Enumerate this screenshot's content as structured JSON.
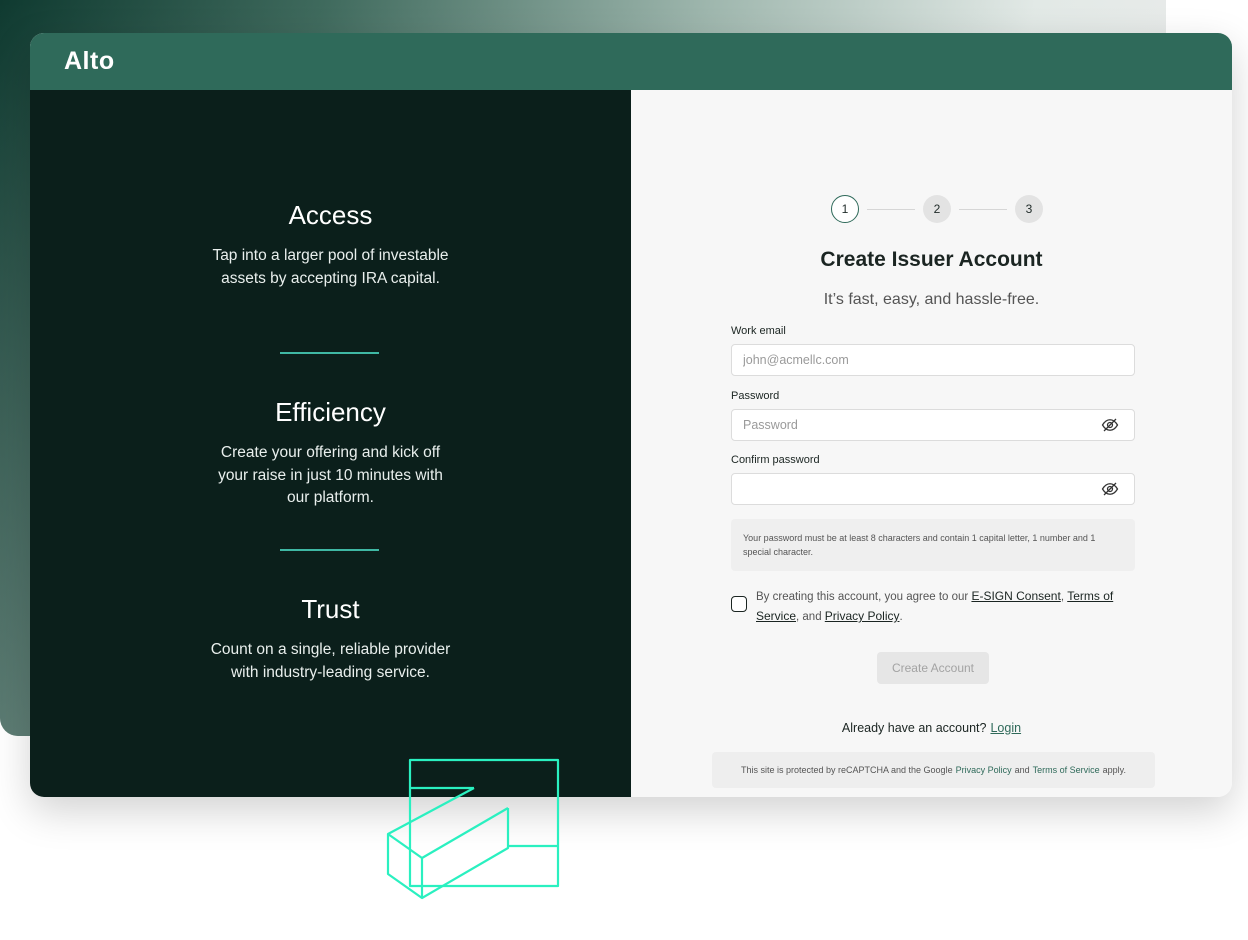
{
  "app": {
    "logo": "Alto"
  },
  "features": [
    {
      "title": "Access",
      "description": "Tap into a larger pool of investable assets by accepting IRA capital."
    },
    {
      "title": "Efficiency",
      "description": "Create your offering and kick off your raise in just 10 minutes with our platform."
    },
    {
      "title": "Trust",
      "description": "Count on a single, reliable provider with industry-leading service."
    }
  ],
  "stepper": {
    "steps": [
      "1",
      "2",
      "3"
    ],
    "active_step": "1"
  },
  "form": {
    "title": "Create Issuer Account",
    "subtitle": "It’s fast, easy, and hassle-free.",
    "email_label": "Work email",
    "email_placeholder": "john@acmellc.com",
    "email_value": "",
    "password_label": "Password",
    "password_placeholder": "Password",
    "password_value": "",
    "confirm_label": "Confirm password",
    "confirm_placeholder": "",
    "confirm_value": "",
    "password_hint": "Your password must be at least 8 characters and contain 1 capital letter, 1 number and 1 special character.",
    "consent_prefix": "By creating this account, you agree to our",
    "esign_link": "E-SIGN Consent",
    "terms_link": "Terms of Service",
    "consent_and": ", and",
    "privacy_link": "Privacy Policy",
    "consent_suffix": ".",
    "submit_label": "Create Account",
    "login_prompt": "Already have an account?",
    "login_link": "Login",
    "recaptcha_prefix": "This site is protected by reCAPTCHA and the Google",
    "recaptcha_privacy": "Privacy Policy",
    "recaptcha_and": "and",
    "recaptcha_terms": "Terms of Service",
    "recaptcha_suffix": "apply."
  },
  "icons": {
    "eye_off": "eye-off-icon",
    "brand_graphic": "isometric-arrow-graphic"
  },
  "colors": {
    "brand_green": "#2f6a5a",
    "panel_dark": "#0b1f1b",
    "accent_teal": "#3fb8a4",
    "graphic_mint": "#2af0c0"
  }
}
